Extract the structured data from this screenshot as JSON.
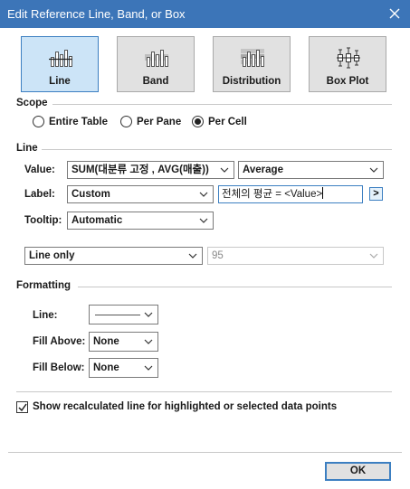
{
  "window": {
    "title": "Edit Reference Line, Band, or Box"
  },
  "types": [
    {
      "label": "Line",
      "icon": "line-chart-icon",
      "selected": true
    },
    {
      "label": "Band",
      "icon": "band-chart-icon",
      "selected": false
    },
    {
      "label": "Distribution",
      "icon": "distribution-chart-icon",
      "selected": false
    },
    {
      "label": "Box Plot",
      "icon": "box-plot-icon",
      "selected": false
    }
  ],
  "scope": {
    "title": "Scope",
    "options": [
      "Entire Table",
      "Per Pane",
      "Per Cell"
    ],
    "selected": "Per Cell"
  },
  "line": {
    "title": "Line",
    "value_label": "Value:",
    "value_field": "SUM(대분류 고정 , AVG(매출))",
    "aggregation": "Average",
    "label_label": "Label:",
    "label_type": "Custom",
    "label_text": "전체의 평균 = <Value>",
    "insert_button": ">",
    "tooltip_label": "Tooltip:",
    "tooltip_value": "Automatic",
    "style": "Line only",
    "confidence": "95"
  },
  "formatting": {
    "title": "Formatting",
    "line_label": "Line:",
    "fill_above_label": "Fill Above:",
    "fill_above_value": "None",
    "fill_below_label": "Fill Below:",
    "fill_below_value": "None"
  },
  "recalc": {
    "label": "Show recalculated line for highlighted or selected data points",
    "checked": true
  },
  "ok_label": "OK",
  "colors": {
    "titlebar": "#3c75b8",
    "selected_tile": "#cce4f7",
    "accent": "#3c7fc1"
  }
}
